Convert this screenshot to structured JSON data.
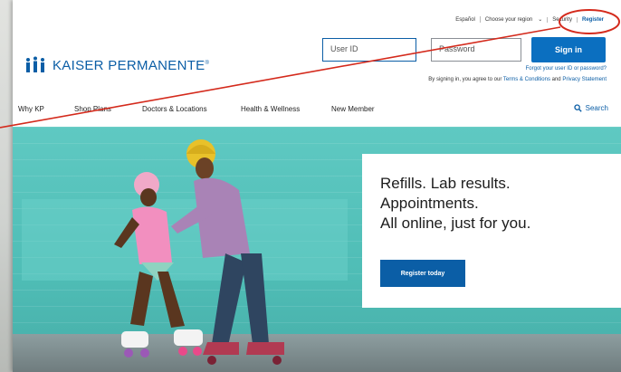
{
  "utility": {
    "language": "Español",
    "region": "Choose your region",
    "security": "Security",
    "register": "Register"
  },
  "logo": {
    "text": "KAISER PERMANENTE",
    "mark": "®"
  },
  "login": {
    "userid_placeholder": "User ID",
    "password_placeholder": "Password",
    "signin": "Sign in",
    "forgot": "Forgot your user ID or password?",
    "agree_prefix": "By signing in, you agree to our",
    "terms": "Terms & Conditions",
    "and": "and",
    "privacy": "Privacy Statement"
  },
  "nav": {
    "items": [
      "Why KP",
      "Shop Plans",
      "Doctors & Locations",
      "Health & Wellness",
      "New Member"
    ],
    "search": "Search"
  },
  "hero": {
    "lines": [
      "Refills. Lab results.",
      "Appointments.",
      "All online, just for you."
    ],
    "cta": "Register today"
  },
  "colors": {
    "brand": "#0b5ea6",
    "annotation": "#d42a1c",
    "hero_bg": "#55c3bc"
  }
}
